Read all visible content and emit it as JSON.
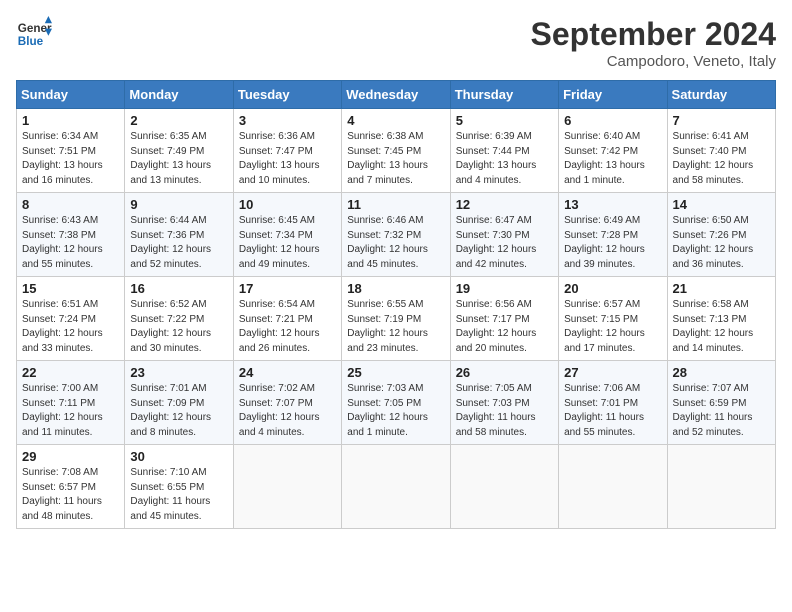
{
  "header": {
    "logo_line1": "General",
    "logo_line2": "Blue",
    "month_title": "September 2024",
    "location": "Campodoro, Veneto, Italy"
  },
  "weekdays": [
    "Sunday",
    "Monday",
    "Tuesday",
    "Wednesday",
    "Thursday",
    "Friday",
    "Saturday"
  ],
  "weeks": [
    [
      {
        "day": "1",
        "sunrise": "6:34 AM",
        "sunset": "7:51 PM",
        "daylight": "13 hours and 16 minutes."
      },
      {
        "day": "2",
        "sunrise": "6:35 AM",
        "sunset": "7:49 PM",
        "daylight": "13 hours and 13 minutes."
      },
      {
        "day": "3",
        "sunrise": "6:36 AM",
        "sunset": "7:47 PM",
        "daylight": "13 hours and 10 minutes."
      },
      {
        "day": "4",
        "sunrise": "6:38 AM",
        "sunset": "7:45 PM",
        "daylight": "13 hours and 7 minutes."
      },
      {
        "day": "5",
        "sunrise": "6:39 AM",
        "sunset": "7:44 PM",
        "daylight": "13 hours and 4 minutes."
      },
      {
        "day": "6",
        "sunrise": "6:40 AM",
        "sunset": "7:42 PM",
        "daylight": "13 hours and 1 minute."
      },
      {
        "day": "7",
        "sunrise": "6:41 AM",
        "sunset": "7:40 PM",
        "daylight": "12 hours and 58 minutes."
      }
    ],
    [
      {
        "day": "8",
        "sunrise": "6:43 AM",
        "sunset": "7:38 PM",
        "daylight": "12 hours and 55 minutes."
      },
      {
        "day": "9",
        "sunrise": "6:44 AM",
        "sunset": "7:36 PM",
        "daylight": "12 hours and 52 minutes."
      },
      {
        "day": "10",
        "sunrise": "6:45 AM",
        "sunset": "7:34 PM",
        "daylight": "12 hours and 49 minutes."
      },
      {
        "day": "11",
        "sunrise": "6:46 AM",
        "sunset": "7:32 PM",
        "daylight": "12 hours and 45 minutes."
      },
      {
        "day": "12",
        "sunrise": "6:47 AM",
        "sunset": "7:30 PM",
        "daylight": "12 hours and 42 minutes."
      },
      {
        "day": "13",
        "sunrise": "6:49 AM",
        "sunset": "7:28 PM",
        "daylight": "12 hours and 39 minutes."
      },
      {
        "day": "14",
        "sunrise": "6:50 AM",
        "sunset": "7:26 PM",
        "daylight": "12 hours and 36 minutes."
      }
    ],
    [
      {
        "day": "15",
        "sunrise": "6:51 AM",
        "sunset": "7:24 PM",
        "daylight": "12 hours and 33 minutes."
      },
      {
        "day": "16",
        "sunrise": "6:52 AM",
        "sunset": "7:22 PM",
        "daylight": "12 hours and 30 minutes."
      },
      {
        "day": "17",
        "sunrise": "6:54 AM",
        "sunset": "7:21 PM",
        "daylight": "12 hours and 26 minutes."
      },
      {
        "day": "18",
        "sunrise": "6:55 AM",
        "sunset": "7:19 PM",
        "daylight": "12 hours and 23 minutes."
      },
      {
        "day": "19",
        "sunrise": "6:56 AM",
        "sunset": "7:17 PM",
        "daylight": "12 hours and 20 minutes."
      },
      {
        "day": "20",
        "sunrise": "6:57 AM",
        "sunset": "7:15 PM",
        "daylight": "12 hours and 17 minutes."
      },
      {
        "day": "21",
        "sunrise": "6:58 AM",
        "sunset": "7:13 PM",
        "daylight": "12 hours and 14 minutes."
      }
    ],
    [
      {
        "day": "22",
        "sunrise": "7:00 AM",
        "sunset": "7:11 PM",
        "daylight": "12 hours and 11 minutes."
      },
      {
        "day": "23",
        "sunrise": "7:01 AM",
        "sunset": "7:09 PM",
        "daylight": "12 hours and 8 minutes."
      },
      {
        "day": "24",
        "sunrise": "7:02 AM",
        "sunset": "7:07 PM",
        "daylight": "12 hours and 4 minutes."
      },
      {
        "day": "25",
        "sunrise": "7:03 AM",
        "sunset": "7:05 PM",
        "daylight": "12 hours and 1 minute."
      },
      {
        "day": "26",
        "sunrise": "7:05 AM",
        "sunset": "7:03 PM",
        "daylight": "11 hours and 58 minutes."
      },
      {
        "day": "27",
        "sunrise": "7:06 AM",
        "sunset": "7:01 PM",
        "daylight": "11 hours and 55 minutes."
      },
      {
        "day": "28",
        "sunrise": "7:07 AM",
        "sunset": "6:59 PM",
        "daylight": "11 hours and 52 minutes."
      }
    ],
    [
      {
        "day": "29",
        "sunrise": "7:08 AM",
        "sunset": "6:57 PM",
        "daylight": "11 hours and 48 minutes."
      },
      {
        "day": "30",
        "sunrise": "7:10 AM",
        "sunset": "6:55 PM",
        "daylight": "11 hours and 45 minutes."
      },
      null,
      null,
      null,
      null,
      null
    ]
  ]
}
